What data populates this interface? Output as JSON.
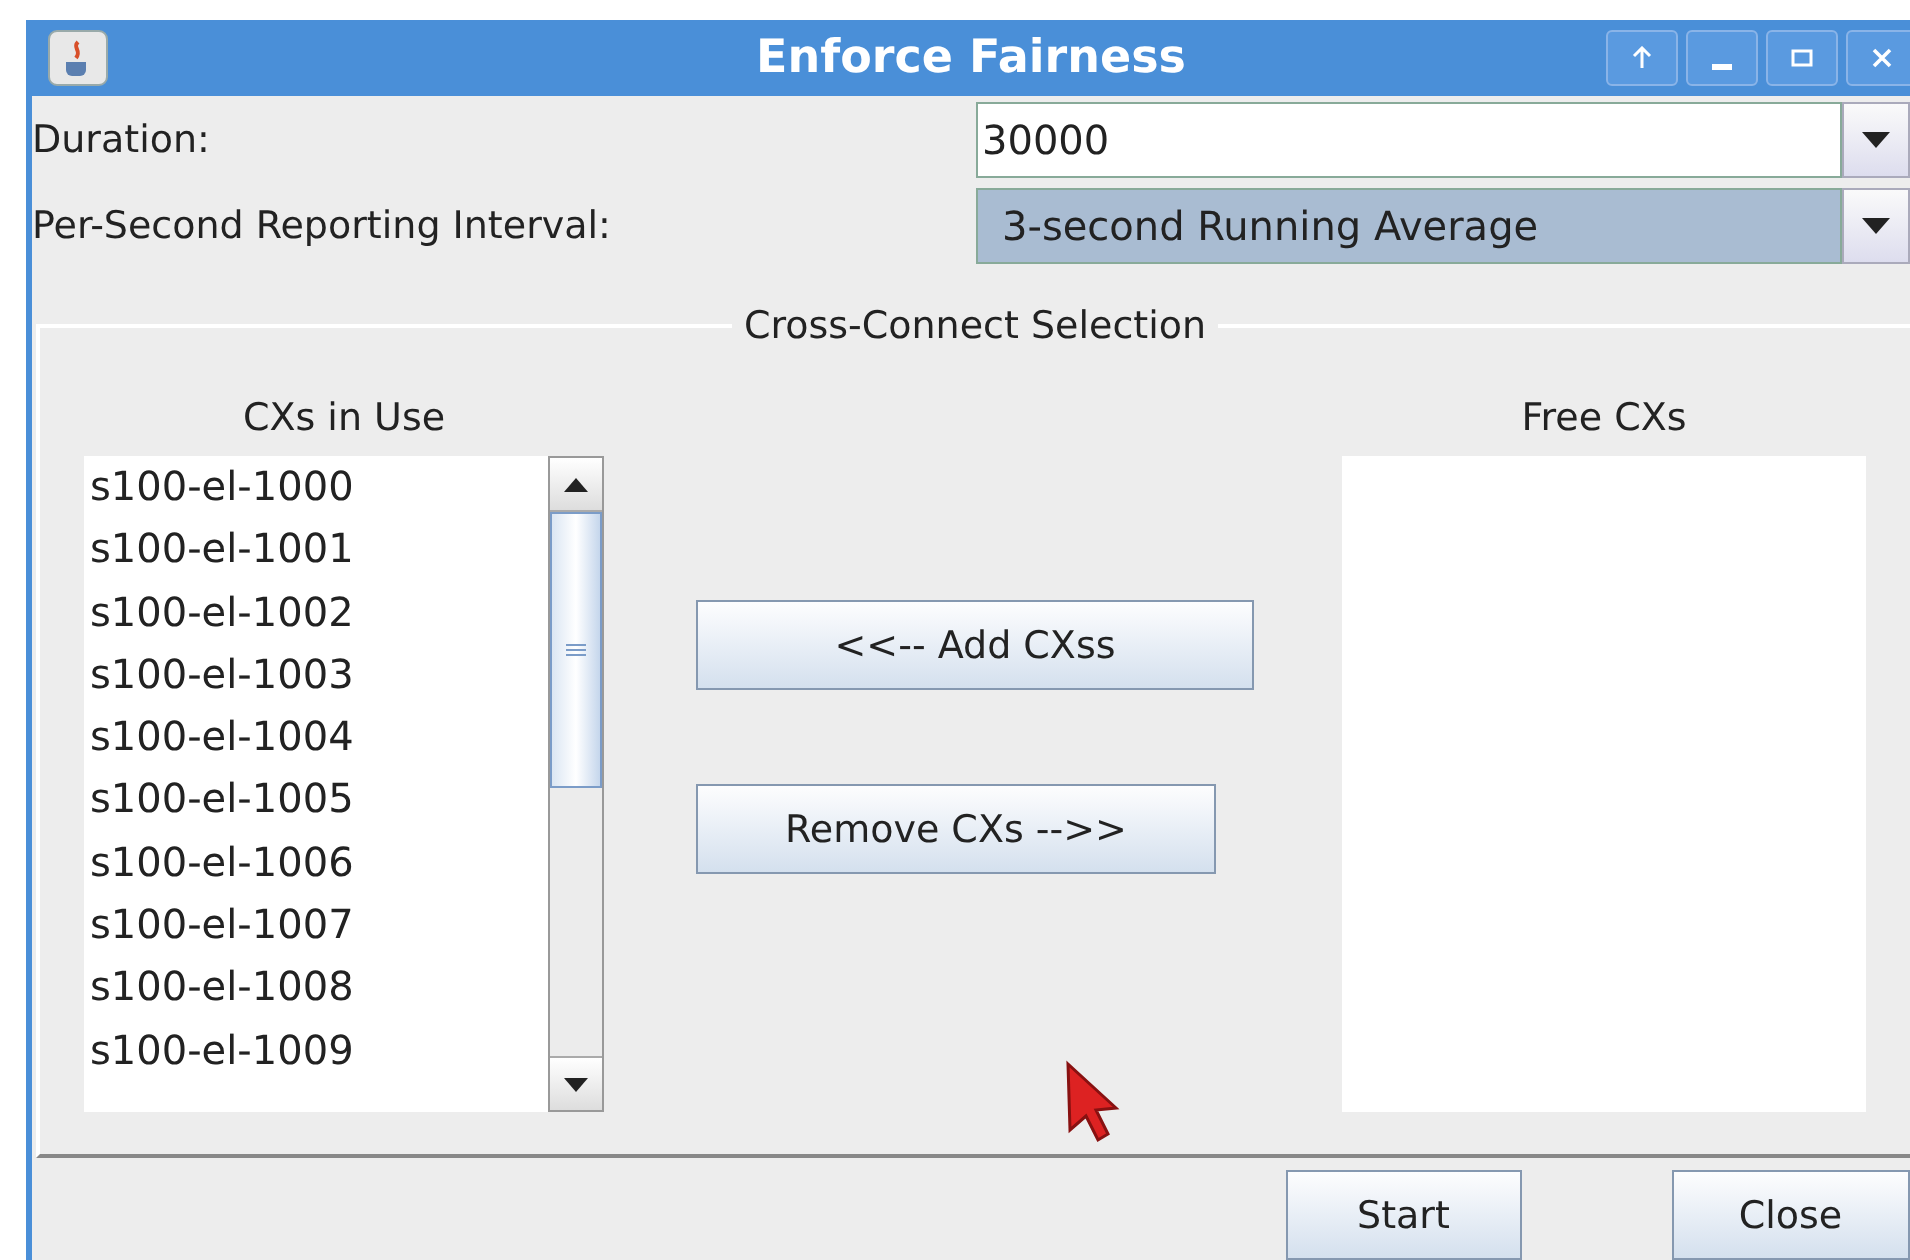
{
  "window": {
    "title": "Enforce Fairness"
  },
  "fields": [
    {
      "label": "Duration:",
      "value": "30000",
      "kind": "editable"
    },
    {
      "label": "Per-Second Reporting Interval:",
      "value": "3-second Running Average",
      "kind": "readonly"
    }
  ],
  "group": {
    "title": "Cross-Connect Selection",
    "in_use": {
      "heading": "CXs in Use",
      "items": [
        "s100-el-1000",
        "s100-el-1001",
        "s100-el-1002",
        "s100-el-1003",
        "s100-el-1004",
        "s100-el-1005",
        "s100-el-1006",
        "s100-el-1007",
        "s100-el-1008",
        "s100-el-1009"
      ]
    },
    "buttons": [
      "<<-- Add CXss",
      "Remove CXs -->>"
    ],
    "free": {
      "heading": "Free CXs"
    }
  },
  "buttons": [
    "Start",
    "Close"
  ]
}
